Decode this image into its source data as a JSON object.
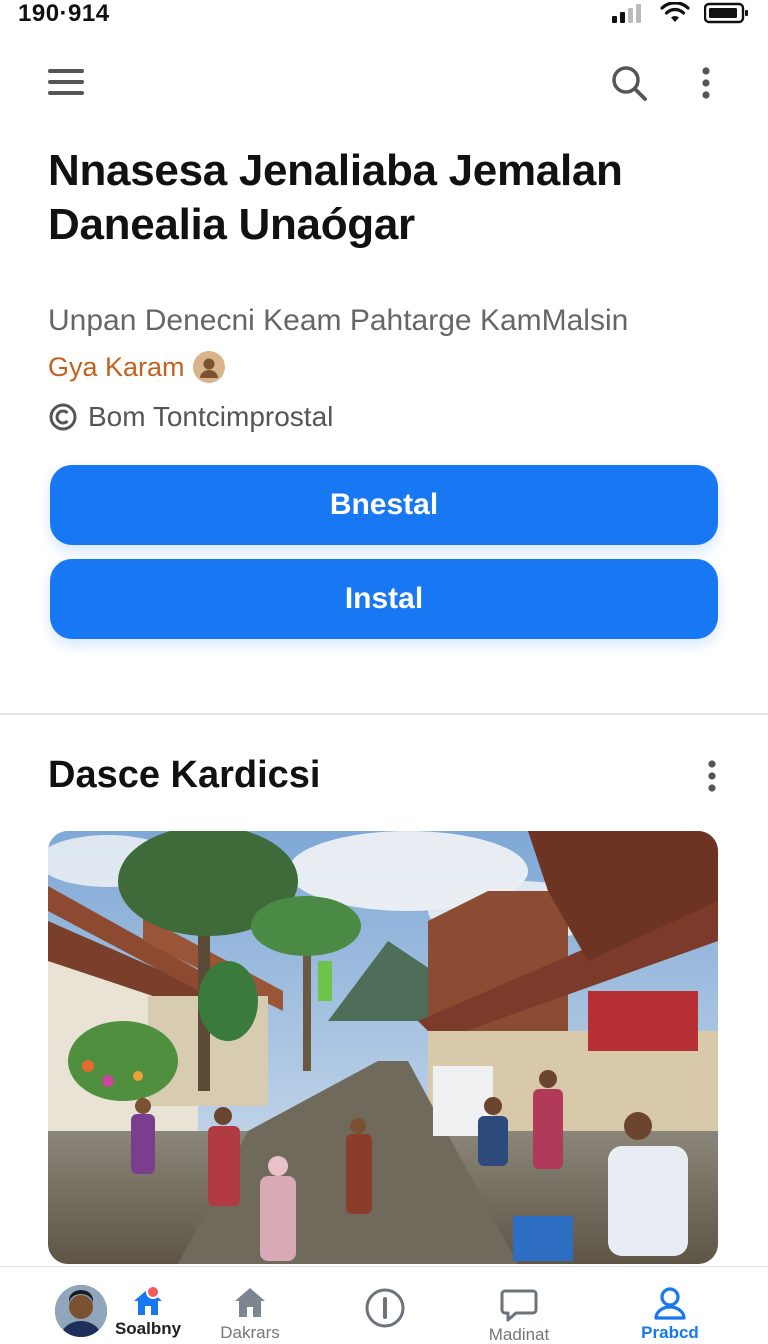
{
  "status_bar": {
    "time": "190·914"
  },
  "header": {
    "title": "Nnasesa Jenaliaba Jemalan Danealia Unaógar",
    "subtitle": "Unpan Denecni Keam Pahtarge KamMalsin",
    "author": "Gya Karam",
    "meta": "Bom Tontcimprostal"
  },
  "buttons": {
    "primary_label": "Bnestal",
    "install_label": "Instal"
  },
  "section": {
    "title": "Dasce Kardicsi"
  },
  "bottom_nav": {
    "items": [
      {
        "label": "Soalbny",
        "icon": "home-icon",
        "badge": true
      },
      {
        "label": "Dakrars",
        "icon": "house-icon"
      },
      {
        "label": "",
        "icon": "alert-icon"
      },
      {
        "label": "Madinat",
        "icon": "chat-icon"
      },
      {
        "label": "Prabcd",
        "icon": "profile-icon",
        "active": true
      }
    ]
  },
  "colors": {
    "accent": "#1877f2",
    "author": "#c2621f",
    "badge": "#f05a5a"
  }
}
